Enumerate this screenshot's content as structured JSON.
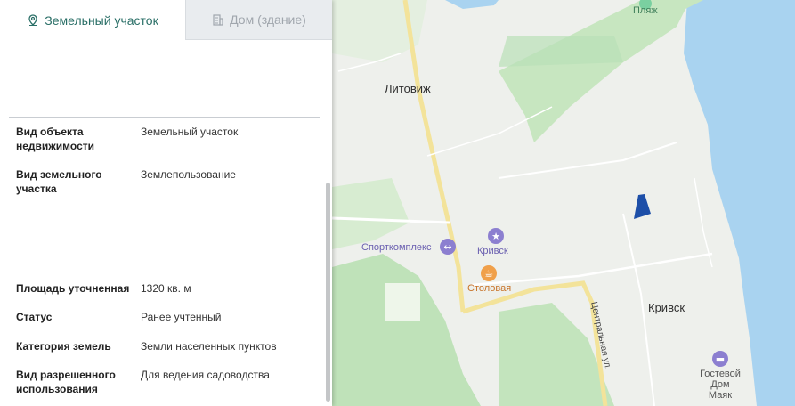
{
  "tabs": [
    {
      "label": "Земельный участок",
      "icon": "location-pin-icon",
      "active": true
    },
    {
      "label": "Дом (здание)",
      "icon": "building-icon",
      "active": false
    }
  ],
  "details": [
    {
      "key": "Вид объекта недвижимости",
      "value": "Земельный участок"
    },
    {
      "key": "Вид земельного участка",
      "value": "Землепользование"
    },
    {
      "key": "Площадь уточненная",
      "value": "1320 кв. м"
    },
    {
      "key": "Статус",
      "value": "Ранее учтенный"
    },
    {
      "key": "Категория земель",
      "value": "Земли населенных пунктов"
    },
    {
      "key": "Вид разрешенного использования",
      "value": "Для ведения садоводства"
    }
  ],
  "map": {
    "labels": {
      "beach": "Пляж",
      "litovizh": "Литовиж",
      "sportcomplex": "Спорткомплекс",
      "krivsk_poi": "Кривск",
      "canteen": "Столовая",
      "krivsk_town": "Кривск",
      "central_street": "Центральная ул.",
      "guesthouse": "Гостевой Дом Маяк"
    },
    "colors": {
      "water": "#a9d3f0",
      "forest": "#bfe2b9",
      "land": "#eef0ec",
      "road": "#f6e8a6",
      "parcel": "#1d4fa8",
      "poi_purple": "#8c7fd0",
      "poi_orange": "#f0a04a"
    }
  }
}
